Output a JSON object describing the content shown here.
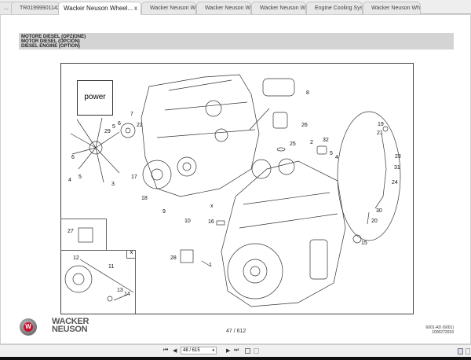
{
  "tabs": [
    {
      "label": "..."
    },
    {
      "label": "TR019999011421 De..."
    },
    {
      "label": "Wacker Neuson Wheel...",
      "active": true
    },
    {
      "label": "Wacker Neuson Whe..."
    },
    {
      "label": "Wacker Neuson Whe..."
    },
    {
      "label": "Wacker Neuson Whe..."
    },
    {
      "label": "Engine Cooling Syste..."
    },
    {
      "label": "Wacker Neuson Whe..."
    }
  ],
  "close_glyph": "x",
  "header": {
    "line1": "MOTORE DIESEL (OPZIONE)",
    "line2": "MOTOR DIESEL (OPCIÓN)",
    "line3": "DIESEL ENGINE (OPTION)"
  },
  "diagram": {
    "power_label": "power",
    "x_mark": "x",
    "callouts": [
      "8",
      "7",
      "22",
      "29",
      "5",
      "6",
      "26",
      "25",
      "2",
      "32",
      "5",
      "4",
      "19",
      "21",
      "23",
      "31",
      "24",
      "30",
      "20",
      "6",
      "5",
      "4",
      "3",
      "17",
      "18",
      "9",
      "10",
      "x",
      "16",
      "27",
      "28",
      "1",
      "15",
      "12",
      "11",
      "13",
      "14"
    ]
  },
  "footer": {
    "brand_line1": "WACKER",
    "brand_line2": "NEUSON",
    "logo_letter": "W",
    "page_number": "47 / 612",
    "ref_line1": "6001-AD (6001)",
    "ref_line2": "1000272033"
  },
  "toolbar": {
    "page_input": "48 / 615",
    "first": "⏮",
    "prev": "◀",
    "next": "▶",
    "last": "⏭"
  }
}
